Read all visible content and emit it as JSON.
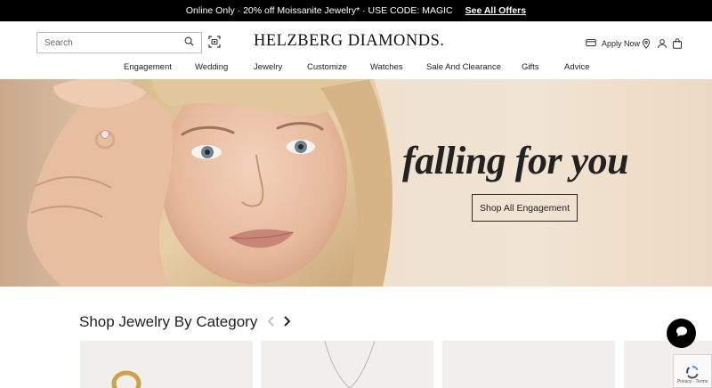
{
  "promo": {
    "text": "Online Only · 20% off Moissanite Jewelry* · USE CODE: MAGIC",
    "link": "See All Offers"
  },
  "header": {
    "search_placeholder": "Search",
    "logo": "HELZBERG DIAMONDS.",
    "apply_now": "Apply Now"
  },
  "nav": {
    "items": [
      "Engagement",
      "Wedding",
      "Jewelry",
      "Customize",
      "Watches",
      "Sale And Clearance",
      "Gifts",
      "Advice"
    ]
  },
  "hero": {
    "title": "falling for you",
    "cta": "Shop All Engagement"
  },
  "categories": {
    "title": "Shop Jewelry By Category"
  },
  "recaptcha": {
    "text": "Privacy - Terms"
  },
  "icons": {
    "search": "search-icon",
    "scan": "camera-scan-icon",
    "card": "credit-card-icon",
    "pin": "location-pin-icon",
    "account": "account-icon",
    "bag": "shopping-bag-icon",
    "prev": "chevron-left-icon",
    "next": "chevron-right-icon",
    "chat": "chat-bubble-icon"
  },
  "colors": {
    "promo_bg": "#000000",
    "text": "#222222",
    "card_bg": "#f1eeec"
  }
}
